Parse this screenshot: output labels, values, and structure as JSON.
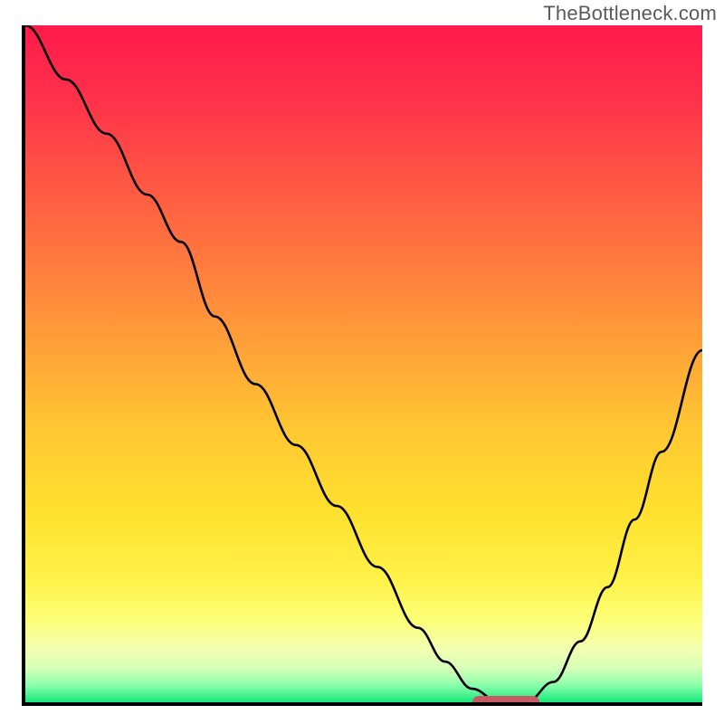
{
  "watermark": "TheBottleneck.com",
  "colors": {
    "top": "#ff1a4b",
    "bottom": "#17e879",
    "curve": "#000000",
    "marker": "#c85a66",
    "axis": "#000000"
  },
  "chart_data": {
    "type": "line",
    "title": "",
    "xlabel": "",
    "ylabel": "",
    "xlim": [
      0,
      100
    ],
    "ylim": [
      0,
      100
    ],
    "x": [
      0,
      6,
      12,
      18,
      23,
      28,
      34,
      40,
      46,
      52,
      58,
      62,
      66,
      70,
      74,
      78,
      82,
      86,
      90,
      94,
      100
    ],
    "values": [
      100,
      92,
      84,
      75,
      68,
      57,
      47,
      38,
      29,
      20,
      11,
      6,
      2,
      0,
      0,
      3,
      9,
      17,
      27,
      37,
      52
    ],
    "marker": {
      "x_start": 66,
      "x_end": 76,
      "y": 0
    }
  }
}
